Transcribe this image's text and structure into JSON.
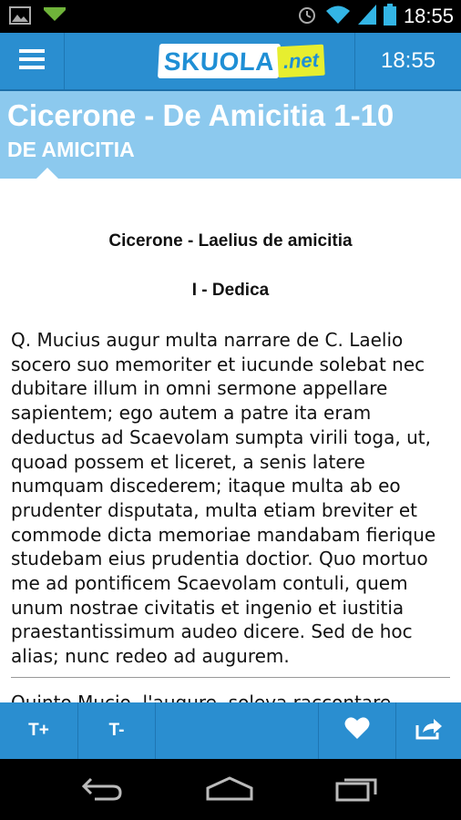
{
  "status_bar": {
    "time": "18:55",
    "icons": [
      "image-icon",
      "download-icon",
      "alarm-icon",
      "wifi-icon",
      "signal-icon",
      "battery-icon"
    ]
  },
  "app_bar": {
    "logo_main": "SKUOLA",
    "logo_suffix": ".net",
    "clock": "18:55",
    "brand_color": "#2a8ed0"
  },
  "header": {
    "title": "Cicerone - De Amicitia 1-10",
    "subtitle": "DE AMICITIA",
    "band_color": "#8cc9ee"
  },
  "article": {
    "heading": "Cicerone - Laelius de amicitia",
    "section": "I - Dedica",
    "lines": [
      "Q. Mucius augur multa narrare de C. Laelio",
      "socero suo memoriter et iucunde solebat nec",
      "dubitare illum in omni sermone appellare",
      "sapientem; ego autem a patre ita eram",
      "deductus ad Scaevolam sumpta virili toga, ut,",
      "quoad possem et liceret, a senis latere",
      "numquam discederem; itaque multa ab eo",
      "prudenter disputata, multa etiam breviter et",
      "commode dicta memoriae mandabam fierique",
      "studebam eius prudentia doctior. Quo mortuo",
      "me ad pontificem Scaevolam contuli, quem",
      "unum nostrae civitatis et ingenio et iustitia",
      "praestantissimum audeo dicere. Sed de hoc",
      "alias; nunc redeo ad augurem."
    ],
    "translation_start": "Quinto Mucio, l'augure, soleva raccontare"
  },
  "toolbar": {
    "increase_text": "T+",
    "decrease_text": "T-"
  }
}
